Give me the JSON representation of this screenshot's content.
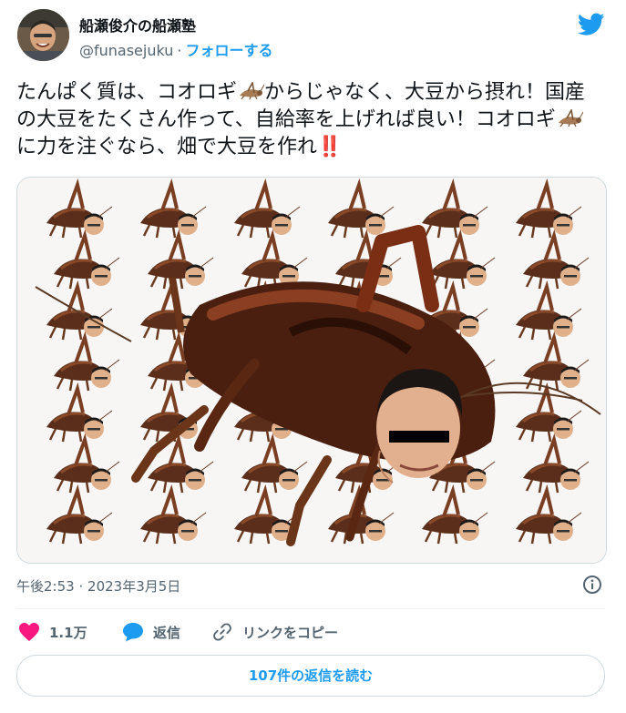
{
  "author": {
    "name": "船瀬俊介の船瀬塾",
    "handle": "@funasejuku",
    "separator": "·",
    "follow_label": "フォローする",
    "avatar_icon": "user-avatar",
    "platform_icon": "twitter-bird-icon"
  },
  "tweet": {
    "text_part1": "たんぱく質は、コオロギ",
    "text_part2": "からじゃなく、大豆から摂れ！国産の大豆をたくさん作って、自給率を上げれば良い！コオロギ",
    "text_part3": "に力を注ぐなら、畑で大豆を作れ",
    "inline_emoji": "cricket-emoji",
    "ending_emoji": "‼️"
  },
  "media": {
    "description_icon": "cricket-image",
    "alt": ""
  },
  "meta": {
    "time": "午後2:53",
    "separator": "·",
    "date": "2023年3月5日",
    "info_icon": "info-icon"
  },
  "actions": {
    "like_count": "1.1万",
    "reply_label": "返信",
    "copy_link_label": "リンクをコピー"
  },
  "more_replies_label": "107件の返信を読む",
  "colors": {
    "accent": "#1d9bf0",
    "like": "#f91880",
    "text": "#0f1419",
    "secondary": "#536471",
    "border": "#cfd9de"
  }
}
